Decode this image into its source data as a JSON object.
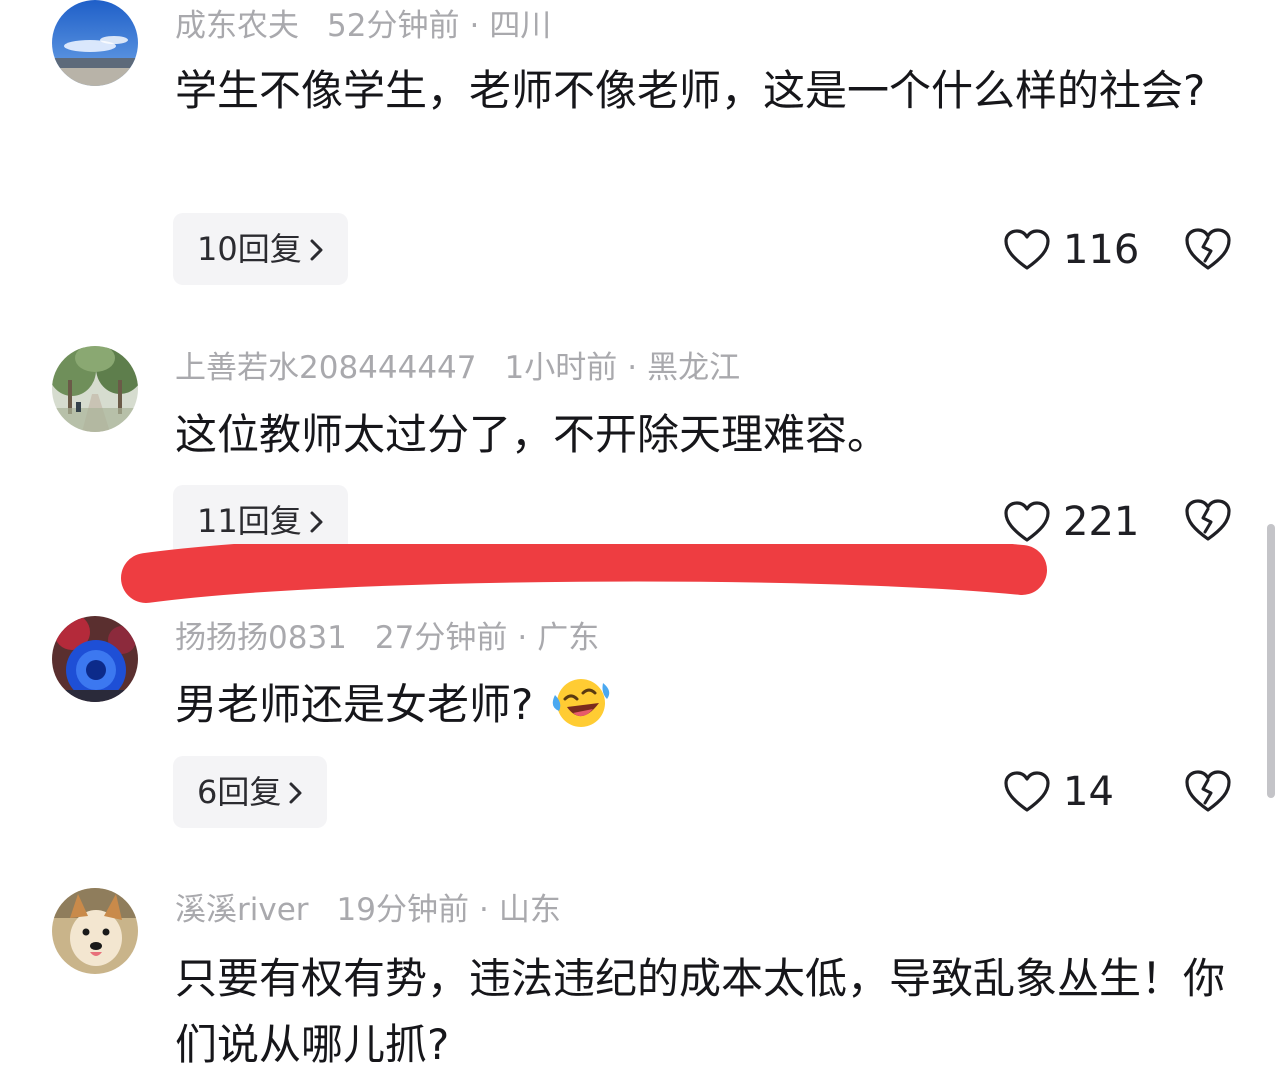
{
  "comments": [
    {
      "username": "成东农夫",
      "time": "52分钟前",
      "location": "四川",
      "text": "学生不像学生，老师不像老师，这是一个什么样的社会?",
      "replies": "10回复",
      "likes": "116",
      "avatar_icon": "sky-landscape-avatar"
    },
    {
      "username": "上善若水208444447",
      "time": "1小时前",
      "location": "黑龙江",
      "text": "这位教师太过分了，不开除天理难容。",
      "replies": "11回复",
      "likes": "221",
      "avatar_icon": "tree-path-avatar"
    },
    {
      "username": "扬扬扬0831",
      "time": "27分钟前",
      "location": "广东",
      "text": "男老师还是女老师?",
      "replies": "6回复",
      "likes": "14",
      "avatar_icon": "blue-flower-avatar",
      "emoji": "laughing-crying-emoji"
    },
    {
      "username": "溪溪river",
      "time": "19分钟前",
      "location": "山东",
      "text": "只要有权有势，违法违纪的成本太低，导致乱象丛生！你们说从哪儿抓?",
      "avatar_icon": "dog-avatar"
    }
  ],
  "separator": "·",
  "icons": {
    "like": "heart-outline-icon",
    "dislike": "broken-heart-icon",
    "chevron": "chevron-right-icon"
  },
  "colors": {
    "highlight_stroke": "#ee3d41",
    "meta_text": "#a9a9ad",
    "body_text": "#16161a",
    "reply_bg": "#f4f4f6"
  }
}
